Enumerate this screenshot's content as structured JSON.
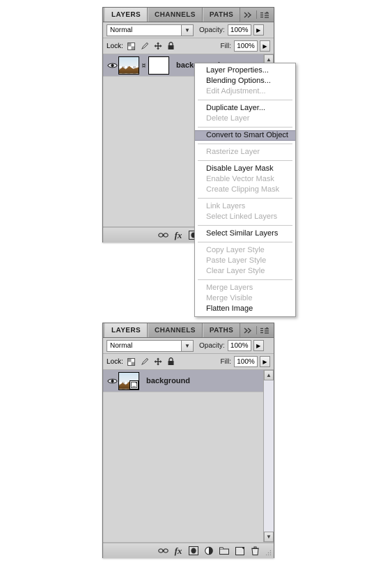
{
  "panels": [
    {
      "id": "top",
      "tabs": [
        {
          "label": "LAYERS",
          "active": true
        },
        {
          "label": "CHANNELS",
          "active": false
        },
        {
          "label": "PATHS",
          "active": false
        }
      ],
      "blend_mode": "Normal",
      "opacity_label": "Opacity:",
      "opacity_value": "100%",
      "lock_label": "Lock:",
      "fill_label": "Fill:",
      "fill_value": "100%",
      "layer": {
        "name": "background",
        "has_mask": true,
        "has_smart_object_badge": false,
        "visible": true,
        "selected": true
      }
    },
    {
      "id": "bottom",
      "tabs": [
        {
          "label": "LAYERS",
          "active": true
        },
        {
          "label": "CHANNELS",
          "active": false
        },
        {
          "label": "PATHS",
          "active": false
        }
      ],
      "blend_mode": "Normal",
      "opacity_label": "Opacity:",
      "opacity_value": "100%",
      "lock_label": "Lock:",
      "fill_label": "Fill:",
      "fill_value": "100%",
      "layer": {
        "name": "background",
        "has_mask": false,
        "has_smart_object_badge": true,
        "visible": true,
        "selected": true
      }
    }
  ],
  "context_menu": {
    "items": [
      {
        "label": "Layer Properties...",
        "state": "enabled"
      },
      {
        "label": "Blending Options...",
        "state": "enabled"
      },
      {
        "label": "Edit Adjustment...",
        "state": "disabled"
      },
      {
        "type": "separator"
      },
      {
        "label": "Duplicate Layer...",
        "state": "enabled"
      },
      {
        "label": "Delete Layer",
        "state": "disabled"
      },
      {
        "type": "separator"
      },
      {
        "label": "Convert to Smart Object",
        "state": "selected"
      },
      {
        "type": "separator"
      },
      {
        "label": "Rasterize Layer",
        "state": "disabled"
      },
      {
        "type": "separator"
      },
      {
        "label": "Disable Layer Mask",
        "state": "enabled"
      },
      {
        "label": "Enable Vector Mask",
        "state": "disabled"
      },
      {
        "label": "Create Clipping Mask",
        "state": "disabled"
      },
      {
        "type": "separator"
      },
      {
        "label": "Link Layers",
        "state": "disabled"
      },
      {
        "label": "Select Linked Layers",
        "state": "disabled"
      },
      {
        "type": "separator"
      },
      {
        "label": "Select Similar Layers",
        "state": "enabled"
      },
      {
        "type": "separator"
      },
      {
        "label": "Copy Layer Style",
        "state": "disabled"
      },
      {
        "label": "Paste Layer Style",
        "state": "disabled"
      },
      {
        "label": "Clear Layer Style",
        "state": "disabled"
      },
      {
        "type": "separator"
      },
      {
        "label": "Merge Layers",
        "state": "disabled"
      },
      {
        "label": "Merge Visible",
        "state": "disabled"
      },
      {
        "label": "Flatten Image",
        "state": "enabled"
      }
    ]
  },
  "lock_icons": [
    "lock-transparency-icon",
    "lock-image-icon",
    "lock-position-icon",
    "lock-all-icon"
  ],
  "tool_icons": [
    "link-layers-icon",
    "add-layer-style-icon",
    "add-layer-mask-icon",
    "new-adjustment-layer-icon",
    "new-group-icon",
    "new-layer-icon",
    "delete-layer-icon"
  ],
  "colors": {
    "panel_bg": "#d4d4d4",
    "tab_active": "#e2e2e2",
    "menu_bg": "#ffffff",
    "menu_highlight": "#adadbd",
    "layer_selected": "#acacb8",
    "disabled_text": "#adadad"
  }
}
